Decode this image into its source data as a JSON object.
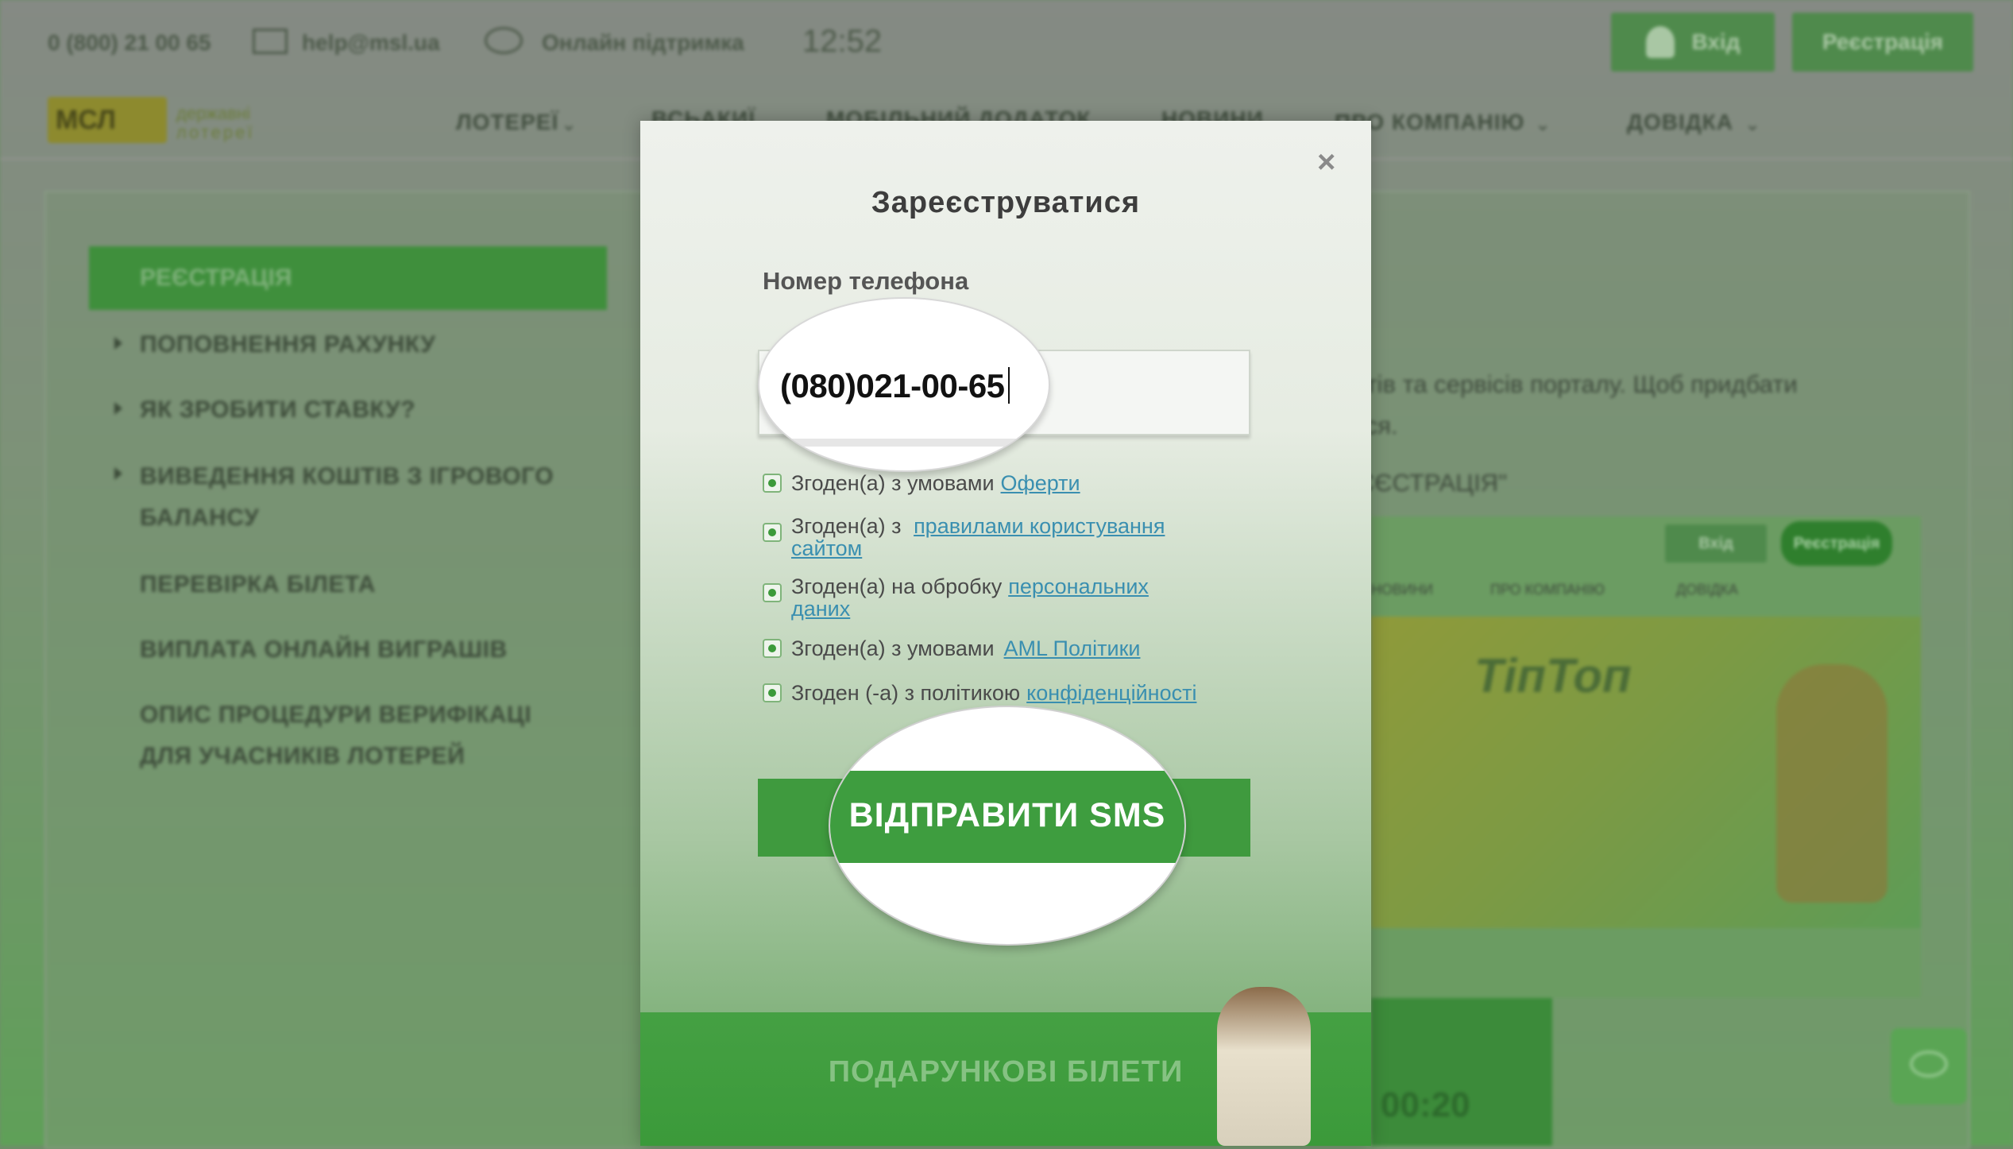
{
  "topbar": {
    "phone": "0 (800) 21 00 65",
    "email": "help@msl.ua",
    "support": "Онлайн підтримка",
    "time": "12:52",
    "login_label": "Вхід",
    "register_label": "Реєстрація"
  },
  "logo": {
    "mark": "МСЛ",
    "tagline_1": "державні",
    "tagline_2": "лотереї"
  },
  "nav": {
    "items": [
      "ЛОТЕРЕЇ",
      "ВСЬАКИЇ",
      "МОБІЛЬНИЙ ДОДАТОК",
      "НОВИНИ",
      "ПРО КОМПАНІЮ",
      "ДОВІДКА"
    ]
  },
  "sidebar": {
    "active": "РЕЄСТРАЦІЯ",
    "items": [
      "ПОПОВНЕННЯ РАХУНКУ",
      "ЯК ЗРОБИТИ СТАВКУ?",
      "ВИВЕДЕННЯ КОШТІВ З ІГРОВОГО",
      "БАЛАНСУ",
      "ПЕРЕВІРКА БІЛЕТА",
      "ВИПЛАТА ОНЛАЙН ВИГРАШІВ",
      "ОПИС ПРОЦЕДУРИ ВЕРИФІКАЦІ",
      "ДЛЯ УЧАСНИКІВ ЛОТЕРЕЙ"
    ]
  },
  "content": {
    "line1": "уктів та сервісів порталу. Щоб придбати",
    "line2": "гися.",
    "line3": "ЄЄСТРАЦІЯ\"",
    "preview_login": "Вхід",
    "preview_register": "Реєстрація",
    "preview_nav_1": "НОВИНИ",
    "preview_nav_2": "ПРО КОМПАНІЮ",
    "preview_nav_3": "ДОВІДКА",
    "banner_brand": "ТіпТоп",
    "timer": "00:20"
  },
  "modal": {
    "title": "Зареєструватися",
    "close": "×",
    "phone_label": "Номер телефона",
    "phone_value": "(080)021-00-65",
    "checks": [
      {
        "text": "Згоден(а) з умовами",
        "link": "Оферти"
      },
      {
        "text": "Згоден(а) з ",
        "link": "правилами користування",
        "link2": "сайтом"
      },
      {
        "text": "Згоден(а) на обробку",
        "link": "персональних",
        "link2": "даних"
      },
      {
        "text": "Згоден(а) з умовами",
        "link": "AML Політики"
      },
      {
        "text": "Згоден (-а) з політикою",
        "link": "конфіденційності"
      }
    ],
    "sms_button": "ВІДПРАВИТИ SMS",
    "gift_label": "ПОДАРУНКОВІ БІЛЕТИ"
  },
  "colors": {
    "accent": "#3f9a3e",
    "overlay": "#6a9a63",
    "link": "#3a8fb0"
  }
}
